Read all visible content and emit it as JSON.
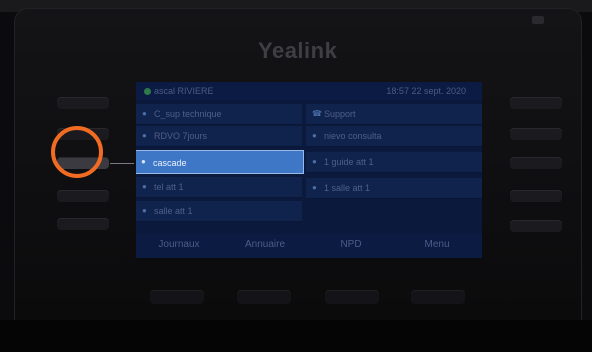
{
  "brand": "Yealink",
  "status": {
    "account": "ascal RIVIERE",
    "clock": "18:57 22 sept. 2020"
  },
  "left_keys": [
    {
      "label": "C_sup technique",
      "icon": "person-icon"
    },
    {
      "label": "RDVO 7jours",
      "icon": "person-icon"
    },
    {
      "label": "cascade",
      "icon": "person-icon",
      "selected": true
    },
    {
      "label": "tel att 1",
      "icon": "person-icon"
    },
    {
      "label": "salle att 1",
      "icon": "person-icon"
    }
  ],
  "right_keys": [
    {
      "label": "Support",
      "icon": "phone-icon"
    },
    {
      "label": "nievo consulta",
      "icon": "person-icon"
    },
    {
      "label": "1 guide att 1",
      "icon": "person-icon"
    },
    {
      "label": "1 salle att 1",
      "icon": "person-icon"
    }
  ],
  "softkeys": [
    "Journaux",
    "Annuaire",
    "NPD",
    "Menu"
  ],
  "icons": {
    "person": "👤",
    "phone": "☎"
  }
}
